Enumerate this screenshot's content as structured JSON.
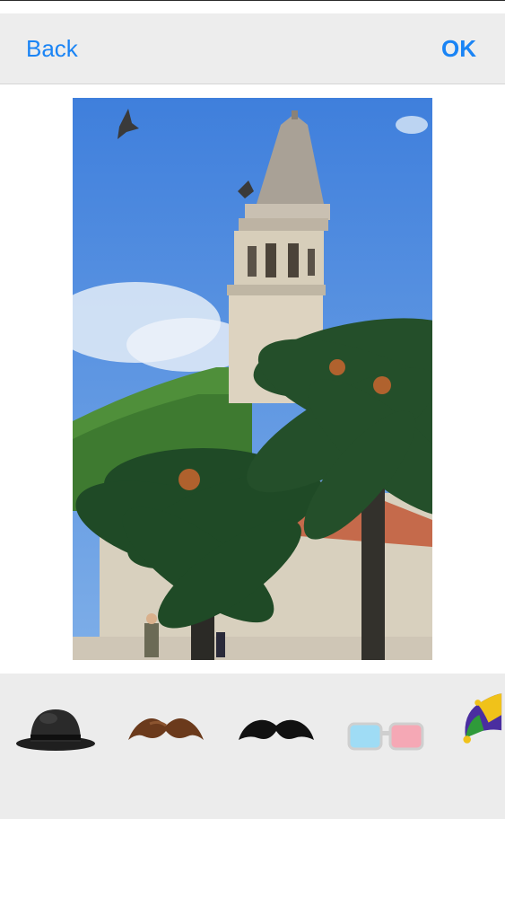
{
  "nav": {
    "back_label": "Back",
    "ok_label": "OK"
  },
  "colors": {
    "accent": "#1a84f5",
    "bar_background": "#ededed",
    "tray_background": "#ececec"
  },
  "photo": {
    "description_icon": "photo-image"
  },
  "stickers": [
    {
      "name": "bowler-hat-icon"
    },
    {
      "name": "brown-mustache-icon"
    },
    {
      "name": "black-mustache-icon"
    },
    {
      "name": "3d-glasses-icon"
    },
    {
      "name": "jester-hat-icon"
    }
  ]
}
